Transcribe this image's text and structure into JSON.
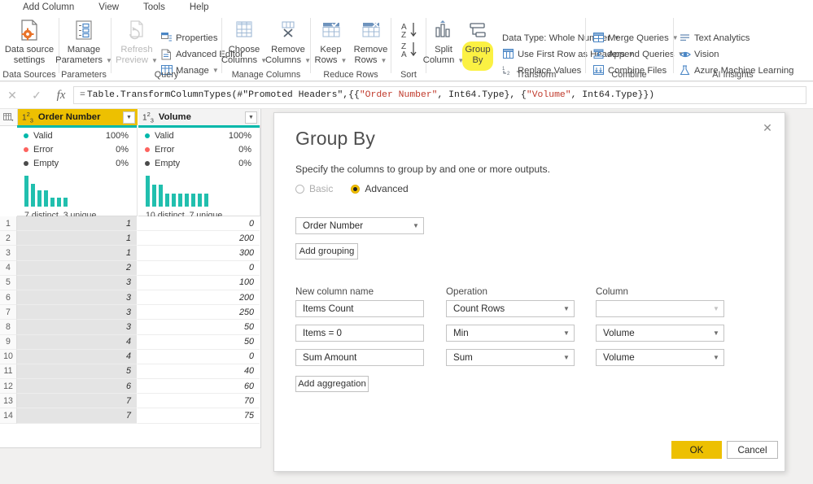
{
  "menubar": {
    "items": [
      {
        "label": "Add Column"
      },
      {
        "label": "View"
      },
      {
        "label": "Tools"
      },
      {
        "label": "Help"
      }
    ]
  },
  "ribbon": {
    "groups": [
      {
        "name": "Data Sources",
        "label": "Data Sources"
      },
      {
        "name": "Parameters",
        "label": "Parameters"
      },
      {
        "name": "Query",
        "label": "Query"
      },
      {
        "name": "Manage Columns",
        "label": "Manage Columns"
      },
      {
        "name": "Reduce Rows",
        "label": "Reduce Rows"
      },
      {
        "name": "Sort",
        "label": "Sort"
      },
      {
        "name": "Transform",
        "label": "Transform"
      },
      {
        "name": "Combine",
        "label": "Combine"
      },
      {
        "name": "AI Insights",
        "label": "AI Insights"
      }
    ],
    "big_buttons": {
      "data_source_settings": "Data source\nsettings",
      "data_source_settings_l1": "Data source",
      "data_source_settings_l2": "settings",
      "manage_parameters_l1": "Manage",
      "manage_parameters_l2": "Parameters",
      "refresh_preview_l1": "Refresh",
      "refresh_preview_l2": "Preview",
      "choose_columns_l1": "Choose",
      "choose_columns_l2": "Columns",
      "remove_columns_l1": "Remove",
      "remove_columns_l2": "Columns",
      "keep_rows_l1": "Keep",
      "keep_rows_l2": "Rows",
      "remove_rows_l1": "Remove",
      "remove_rows_l2": "Rows",
      "split_column_l1": "Split",
      "split_column_l2": "Column",
      "group_by_l1": "Group",
      "group_by_l2": "By"
    },
    "small_buttons": {
      "properties": "Properties",
      "advanced_editor": "Advanced Editor",
      "manage": "Manage",
      "data_type": "Data Type: Whole Number",
      "use_first_row": "Use First Row as Headers",
      "replace_values": "Replace Values",
      "merge_queries": "Merge Queries",
      "append_queries": "Append Queries",
      "combine_files": "Combine Files",
      "text_analytics": "Text Analytics",
      "vision": "Vision",
      "azure_ml": "Azure Machine Learning"
    },
    "highlight_color": "#fbf143"
  },
  "formula_bar": {
    "cancel_icon": "✕",
    "accept_icon": "✓",
    "fx_icon": "fx",
    "equals": "=",
    "formula_parts": [
      {
        "text": "Table.TransformColumnTypes(#",
        "type": "plain"
      },
      {
        "text": "\"Promoted Headers\"",
        "type": "plain"
      },
      {
        "text": ",{{",
        "type": "plain"
      },
      {
        "text": "\"Order Number\"",
        "type": "string"
      },
      {
        "text": ", Int64.Type}, {",
        "type": "plain"
      },
      {
        "text": "\"Volume\"",
        "type": "string"
      },
      {
        "text": ", Int64.Type}})",
        "type": "plain"
      }
    ],
    "formula_text": "= Table.TransformColumnTypes(#\"Promoted Headers\",{{\"Order Number\", Int64.Type}, {\"Volume\", Int64.Type}})"
  },
  "grid": {
    "corner_icon": "table-select-icon",
    "columns": [
      {
        "name": "Order Number",
        "type_icon": "123",
        "selected": true,
        "quality": [
          {
            "label": "Valid",
            "value": "100%",
            "color": "#01b8aa"
          },
          {
            "label": "Error",
            "value": "0%",
            "color": "#fd625e"
          },
          {
            "label": "Empty",
            "value": "0%",
            "color": "#4b4b4b"
          }
        ],
        "histogram": [
          38,
          28,
          20,
          20,
          11,
          11,
          11
        ],
        "footer": "7 distinct, 3 unique"
      },
      {
        "name": "Volume",
        "type_icon": "123",
        "selected": false,
        "quality": [
          {
            "label": "Valid",
            "value": "100%",
            "color": "#01b8aa"
          },
          {
            "label": "Error",
            "value": "0%",
            "color": "#fd625e"
          },
          {
            "label": "Empty",
            "value": "0%",
            "color": "#4b4b4b"
          }
        ],
        "histogram": [
          38,
          27,
          27,
          16,
          16,
          16,
          16,
          16,
          16,
          16
        ],
        "footer": "10 distinct, 7 unique"
      }
    ],
    "rows": [
      {
        "n": "1",
        "order_number": "1",
        "volume": "0"
      },
      {
        "n": "2",
        "order_number": "1",
        "volume": "200"
      },
      {
        "n": "3",
        "order_number": "1",
        "volume": "300"
      },
      {
        "n": "4",
        "order_number": "2",
        "volume": "0"
      },
      {
        "n": "5",
        "order_number": "3",
        "volume": "100"
      },
      {
        "n": "6",
        "order_number": "3",
        "volume": "200"
      },
      {
        "n": "7",
        "order_number": "3",
        "volume": "250"
      },
      {
        "n": "8",
        "order_number": "3",
        "volume": "50"
      },
      {
        "n": "9",
        "order_number": "4",
        "volume": "50"
      },
      {
        "n": "10",
        "order_number": "4",
        "volume": "0"
      },
      {
        "n": "11",
        "order_number": "5",
        "volume": "40"
      },
      {
        "n": "12",
        "order_number": "6",
        "volume": "60"
      },
      {
        "n": "13",
        "order_number": "7",
        "volume": "70"
      },
      {
        "n": "14",
        "order_number": "7",
        "volume": "75"
      }
    ]
  },
  "dialog": {
    "title": "Group By",
    "subtitle": "Specify the columns to group by and one or more outputs.",
    "close_icon": "✕",
    "modes": [
      {
        "label": "Basic",
        "selected": false
      },
      {
        "label": "Advanced",
        "selected": true
      }
    ],
    "group_by_column": "Order Number",
    "add_grouping_label": "Add grouping",
    "headers": {
      "new_column_name": "New column name",
      "operation": "Operation",
      "column": "Column"
    },
    "aggregations": [
      {
        "new_column_name": "Items Count",
        "operation": "Count Rows",
        "column": "",
        "column_disabled": true
      },
      {
        "new_column_name": "Items = 0",
        "operation": "Min",
        "column": "Volume",
        "column_disabled": false
      },
      {
        "new_column_name": "Sum Amount",
        "operation": "Sum",
        "column": "Volume",
        "column_disabled": false
      }
    ],
    "add_aggregation_label": "Add aggregation",
    "ok_label": "OK",
    "cancel_label": "Cancel",
    "ok_color": "#edc001"
  }
}
